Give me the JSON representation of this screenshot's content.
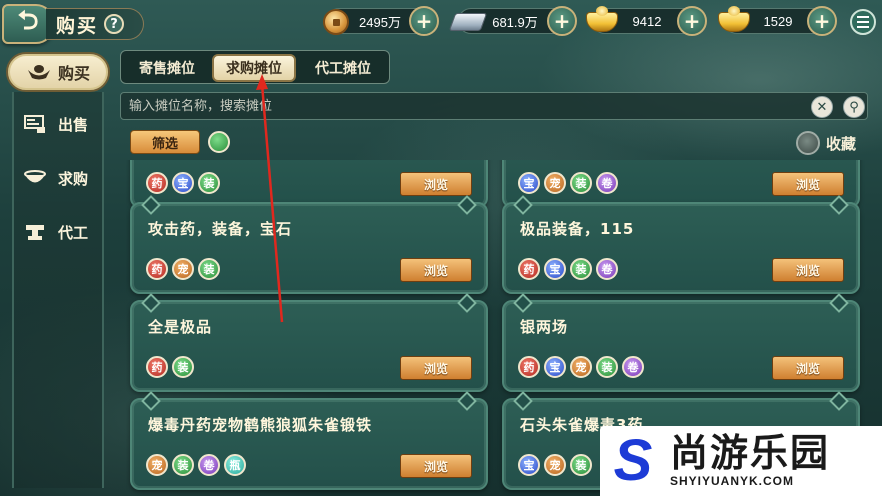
{
  "header": {
    "title": "购买",
    "help": "?"
  },
  "currencies": [
    {
      "name": "copper-coin",
      "value": "2495万"
    },
    {
      "name": "silver",
      "value": "681.9万"
    },
    {
      "name": "gold-ingot",
      "value": "9412"
    },
    {
      "name": "gold-ingot-2",
      "value": "1529"
    }
  ],
  "plus_label": "+",
  "sidebar": {
    "active": {
      "label": "购买",
      "icon": "ingot-icon"
    },
    "items": [
      {
        "label": "出售",
        "icon": "stall-icon"
      },
      {
        "label": "求购",
        "icon": "bowl-icon"
      },
      {
        "label": "代工",
        "icon": "anvil-icon"
      }
    ]
  },
  "tabs": [
    {
      "label": "寄售摊位",
      "active": false
    },
    {
      "label": "求购摊位",
      "active": true
    },
    {
      "label": "代工摊位",
      "active": false
    }
  ],
  "search": {
    "placeholder": "输入摊位名称，搜索摊位",
    "clear_symbol": "✕",
    "search_symbol": "⚲"
  },
  "filter": {
    "label": "筛选"
  },
  "collect": {
    "label": "收藏"
  },
  "browse_label": "浏览",
  "cards": [
    {
      "title": "",
      "icons": [
        "medicine",
        "gem",
        "equip"
      ]
    },
    {
      "title": "",
      "icons": [
        "gem",
        "pet",
        "equip",
        "scroll"
      ]
    },
    {
      "title": "攻击药，装备，宝石",
      "icons": [
        "medicine",
        "pet",
        "equip"
      ]
    },
    {
      "title": "极品装备，115",
      "icons": [
        "medicine",
        "gem",
        "equip",
        "scroll"
      ]
    },
    {
      "title": "全是极品",
      "icons": [
        "medicine",
        "equip"
      ]
    },
    {
      "title": "银两场",
      "icons": [
        "medicine",
        "gem",
        "pet",
        "equip",
        "scroll"
      ]
    },
    {
      "title": "爆毒丹药宠物鹤熊狼狐朱雀锻铁",
      "icons": [
        "pet",
        "equip",
        "scroll",
        "potion"
      ]
    },
    {
      "title": "石头朱雀爆毒3药",
      "icons": [
        "gem",
        "pet",
        "equip"
      ]
    }
  ],
  "colors": {
    "accent_gold": "#cf7f30",
    "panel_green": "#23504a",
    "arrow_red": "#e0281e"
  },
  "watermark": {
    "logo": "S",
    "cn": "尚游乐园",
    "en": "SHYIYUANYK.COM"
  }
}
